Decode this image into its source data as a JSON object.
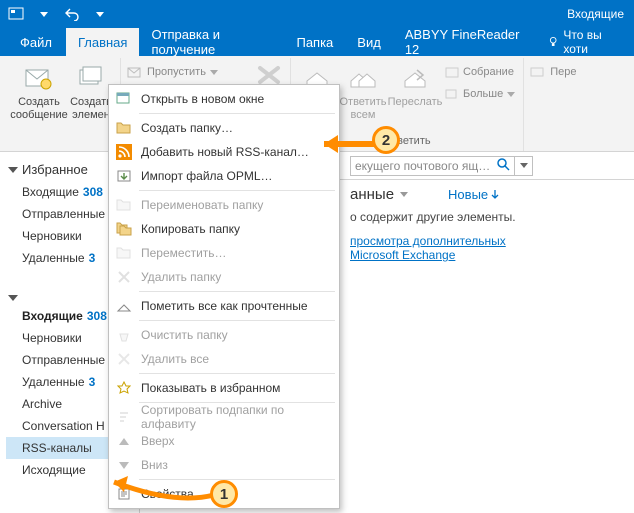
{
  "titlebar": {
    "title": "Входящие"
  },
  "tabs": {
    "file": "Файл",
    "home": "Главная",
    "sendreceive": "Отправка и получение",
    "folder": "Папка",
    "view": "Вид",
    "abbyy": "ABBYY FineReader 12",
    "help": "Что вы хоти"
  },
  "ribbon": {
    "newmsg": "Создать сообщение",
    "newitem": "Создать элемен",
    "ignore": "Пропустить",
    "reply_suffix": "ить",
    "replyall": "Ответить всем",
    "forward": "Переслать",
    "meeting": "Собрание",
    "more": "Больше",
    "group_reply": "Ответить",
    "pere": "Пере"
  },
  "search": {
    "placeholder": "екущего почтового ящ…",
    "icon": "🔍"
  },
  "panehdr": {
    "title": "анные",
    "newbtn": "Новые"
  },
  "reading": {
    "line1": "о содержит другие элементы.",
    "link1": "просмотра дополнительных",
    "link2": "Microsoft Exchange"
  },
  "nav": {
    "fav_hdr": "Избранное",
    "inbox": "Входящие",
    "inbox_count": "308",
    "sent": "Отправленные",
    "drafts": "Черновики",
    "deleted": "Удаленные",
    "del_count": "3",
    "acct_inbox": "Входящие",
    "acct_inbox_count": "308",
    "acct_drafts": "Черновики",
    "acct_sent": "Отправленные",
    "acct_deleted": "Удаленные",
    "acct_del_count": "3",
    "archive": "Archive",
    "convhist": "Conversation H",
    "rss": "RSS-каналы",
    "outbox": "Исходящие"
  },
  "ctx": {
    "open_new": "Открыть в новом окне",
    "new_folder": "Создать папку…",
    "add_rss": "Добавить новый RSS-канал…",
    "import_opml": "Импорт файла OPML…",
    "rename": "Переименовать папку",
    "copy": "Копировать папку",
    "move": "Переместить…",
    "delete": "Удалить папку",
    "markread": "Пометить все как прочтенные",
    "cleanup": "Очистить папку",
    "deleteall": "Удалить все",
    "showfav": "Показывать в избранном",
    "sortabc": "Сортировать подпапки по алфавиту",
    "up": "Вверх",
    "down": "Вниз",
    "props": "Свойства…"
  },
  "annot": {
    "b1": "1",
    "b2": "2"
  }
}
